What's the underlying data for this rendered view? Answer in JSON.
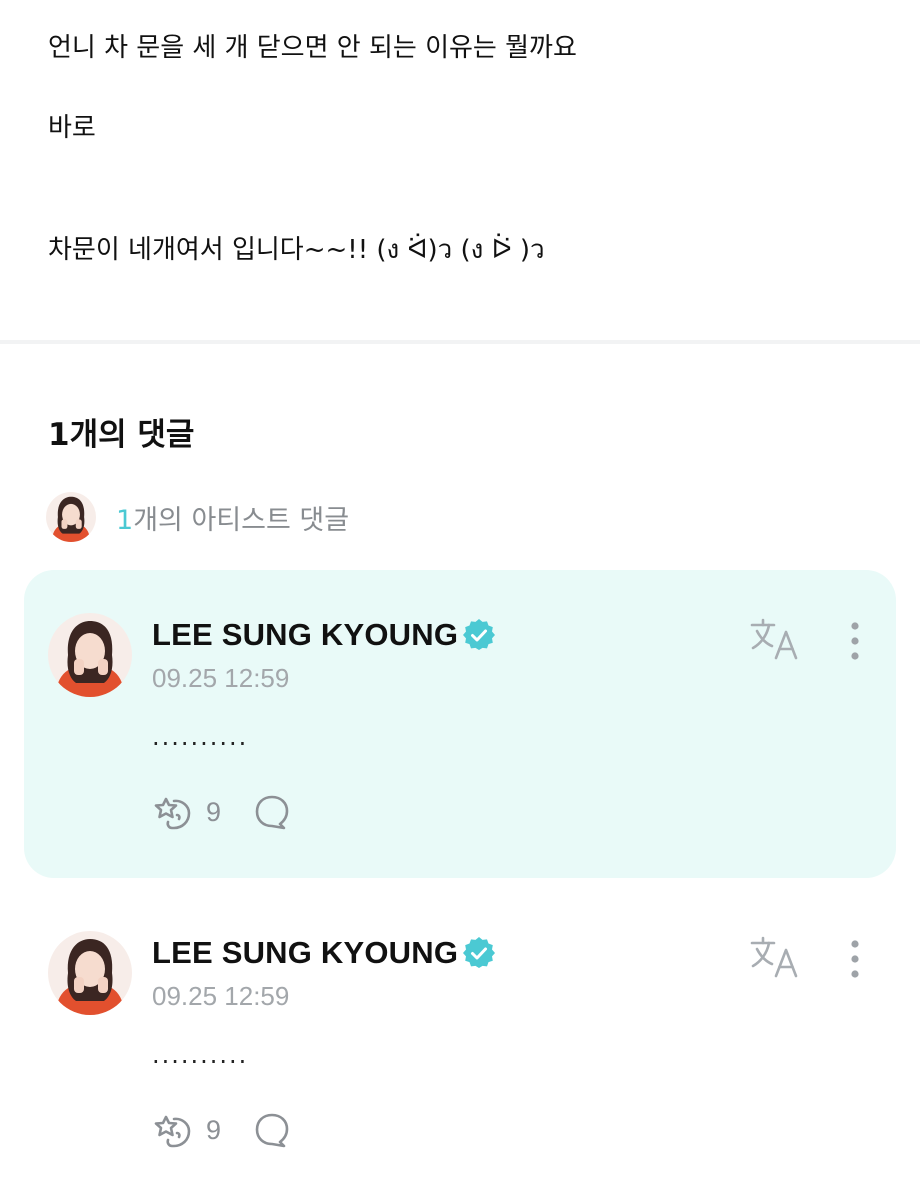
{
  "post": {
    "line1": "언니 차 문을 세 개 닫으면 안 되는 이유는 뭘까요",
    "line2": "바로",
    "line3": "차문이 네개여서 입니다~~!! (ง ᐛ)ว (ง ᐖ )ว"
  },
  "comments_header": {
    "count": "1",
    "label": "개의 댓글"
  },
  "artist_summary": {
    "count": "1",
    "label": "개의 아티스트 댓글"
  },
  "colors": {
    "accent": "#4bc9d3",
    "highlight_bg": "#e9faf8",
    "muted_text": "#a3a7ab"
  },
  "comments": [
    {
      "author": "LEE SUNG KYOUNG",
      "time": "09.25 12:59",
      "body": "..........",
      "reactions": "9",
      "verified": true,
      "highlighted": true
    },
    {
      "author": "LEE SUNG KYOUNG",
      "time": "09.25 12:59",
      "body": "..........",
      "reactions": "9",
      "verified": true,
      "highlighted": false
    }
  ]
}
